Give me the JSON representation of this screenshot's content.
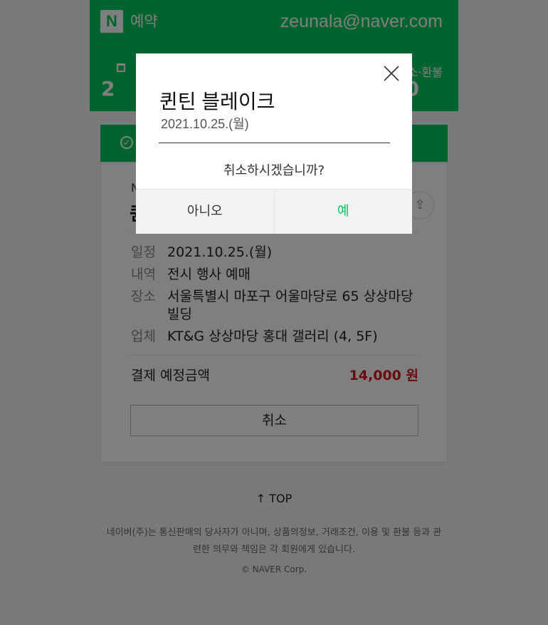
{
  "header": {
    "logo": "N",
    "title": "예약",
    "user_email": "zeunala@naver.com"
  },
  "summary": {
    "left_number": "2",
    "right_label": "소·환불",
    "right_number": "0"
  },
  "card": {
    "label": "N",
    "title_initial": "퀸",
    "share_icon": "share-icon",
    "info": [
      {
        "key": "일정",
        "value": "2021.10.25.(월)"
      },
      {
        "key": "내역",
        "value": "전시 행사 예매"
      },
      {
        "key": "장소",
        "value": "서울특별시 마포구 어울마당로 65 상상마당빌딩"
      },
      {
        "key": "업체",
        "value": "KT&G 상상마당 홍대 갤러리 (4, 5F)"
      }
    ],
    "payment_label": "결제 예정금액",
    "payment_amount": "14,000 원",
    "cancel_button": "취소"
  },
  "footer": {
    "top_link": "↑ TOP",
    "notice": "네이버(주)는 통신판매의 당사자가 아니며, 상품의정보, 거래조건, 이용 및 환불 등과 관련한 의무와 책임은 각 회원에게 있습니다.",
    "copyright": "© NAVER Corp."
  },
  "dialog": {
    "title": "퀸틴 블레이크",
    "date": "2021.10.25.(월)",
    "message": "취소하시겠습니까?",
    "no_button": "아니오",
    "yes_button": "예"
  },
  "colors": {
    "brand_green": "#03c75a",
    "price_red": "#d8141a"
  }
}
